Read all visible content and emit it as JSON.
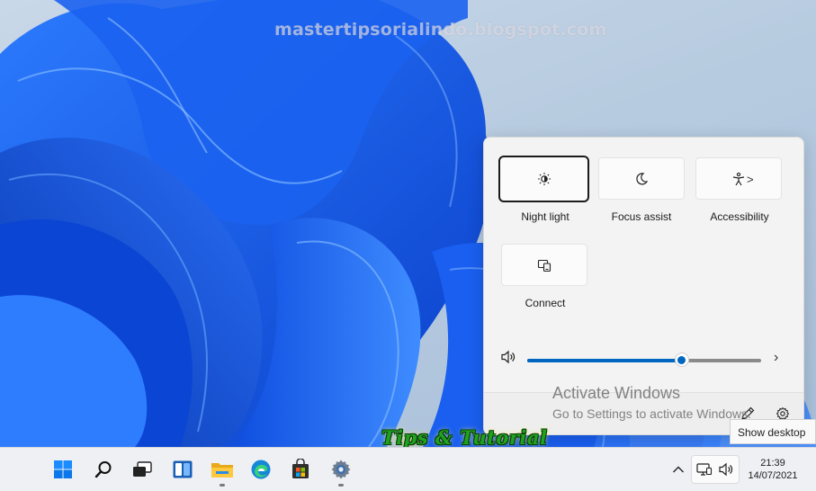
{
  "watermark": "mastertipsorialindo.blogspot.com",
  "brand_overlay": "Tips & Tutorial",
  "quick_settings": {
    "tiles": [
      {
        "label": "Night light",
        "icon": "night-light-icon",
        "focused": true
      },
      {
        "label": "Focus assist",
        "icon": "moon-icon",
        "focused": false
      },
      {
        "label": "Accessibility",
        "icon": "accessibility-icon",
        "chevron": ">",
        "focused": false
      },
      {
        "label": "Connect",
        "icon": "cast-icon",
        "focused": false
      }
    ],
    "volume": {
      "level_percent": 66,
      "icon": "speaker-icon",
      "more_icon": "chevron-right-icon"
    },
    "footer": {
      "edit_icon": "pencil-icon",
      "settings_icon": "gear-icon"
    }
  },
  "activation": {
    "title": "Activate Windows",
    "subtitle": "Go to Settings to activate Windows."
  },
  "tooltip": "Show desktop",
  "taskbar": {
    "apps": [
      {
        "name": "start",
        "icon": "windows-logo-icon",
        "running": false
      },
      {
        "name": "search",
        "icon": "search-icon",
        "running": false
      },
      {
        "name": "task-view",
        "icon": "task-view-icon",
        "running": false
      },
      {
        "name": "widgets",
        "icon": "widgets-icon",
        "running": false
      },
      {
        "name": "file-explorer",
        "icon": "folder-icon",
        "running": true
      },
      {
        "name": "edge",
        "icon": "edge-icon",
        "running": false
      },
      {
        "name": "store",
        "icon": "store-icon",
        "running": false
      },
      {
        "name": "settings",
        "icon": "gear-icon",
        "running": true
      }
    ],
    "tray": {
      "overflow_icon": "chevron-up-icon",
      "network_icon": "network-icon",
      "volume_icon": "speaker-icon",
      "time": "21:39",
      "date": "14/07/2021"
    }
  },
  "colors": {
    "accent": "#0067c0",
    "wallpaper_blue": "#1e5ee8"
  }
}
